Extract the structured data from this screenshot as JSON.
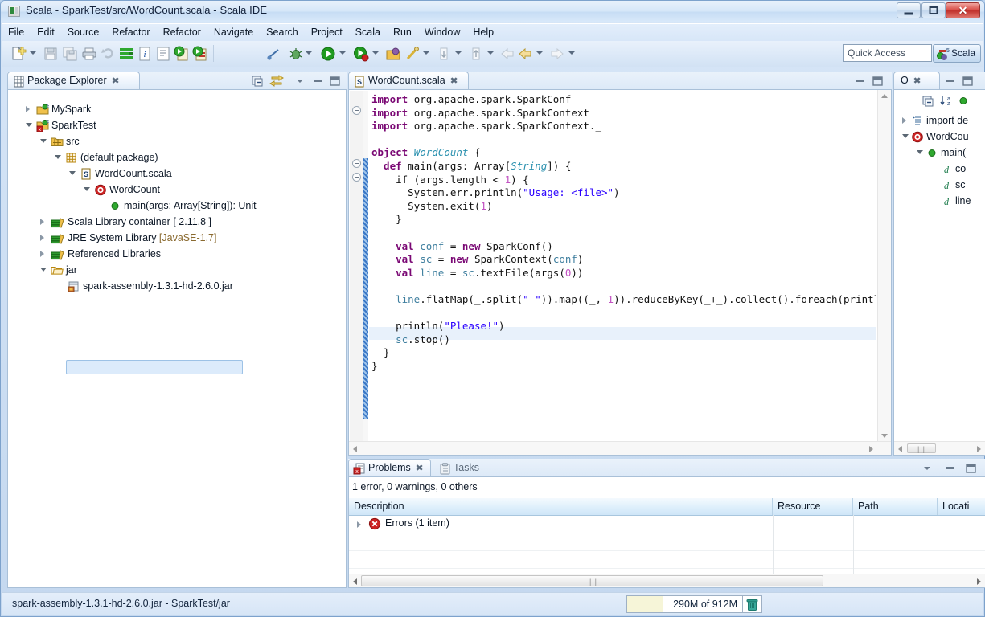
{
  "window": {
    "title": "Scala - SparkTest/src/WordCount.scala - Scala IDE",
    "icon": "scala-ide-icon",
    "controls": {
      "minimize": "–",
      "maximize": "□",
      "close": "✕"
    }
  },
  "menubar": {
    "items": [
      "File",
      "Edit",
      "Source",
      "Refactor",
      "Refactor",
      "Navigate",
      "Search",
      "Project",
      "Scala",
      "Run",
      "Window",
      "Help"
    ]
  },
  "toolbar": {
    "icons": [
      "new-wizard-icon",
      "save-icon",
      "save-all-icon",
      "print-icon",
      "refresh-icon",
      "scala-interpreter-icon",
      "scaladoc-icon",
      "comment-icon",
      "run-scala-app-icon",
      "run-scala-test-icon",
      "toggle-breakpoint-icon",
      "debug-icon",
      "run-icon",
      "run-coverage-icon",
      "open-type-icon",
      "search-icon",
      "next-annotation-icon",
      "previous-annotation-icon",
      "back-icon",
      "forward-icon"
    ],
    "quick_access_placeholder": "Quick Access",
    "quick_access_value": "",
    "open-perspective-icon": "open-perspective-icon",
    "perspective_label": "Scala",
    "perspective_icon": "scala-perspective-icon"
  },
  "package_explorer": {
    "tab_label": "Package Explorer",
    "tab_icon": "package-explorer-icon",
    "close_glyph": "✖",
    "buttons": [
      "collapse-all-icon",
      "link-with-editor-icon",
      "view-menu-icon",
      "minimize-icon",
      "maximize-icon"
    ],
    "tree": [
      {
        "label": "MySpark",
        "indent": 0,
        "twisty": "closed",
        "icon": "scala-project-icon"
      },
      {
        "label": "SparkTest",
        "indent": 0,
        "twisty": "open",
        "icon": "scala-project-error-icon"
      },
      {
        "label": "src",
        "indent": 1,
        "twisty": "open",
        "icon": "source-folder-icon"
      },
      {
        "label": "(default package)",
        "indent": 2,
        "twisty": "open",
        "icon": "package-icon"
      },
      {
        "label": "WordCount.scala",
        "indent": 3,
        "twisty": "open",
        "icon": "scala-file-icon"
      },
      {
        "label": "WordCount",
        "indent": 4,
        "twisty": "open",
        "icon": "scala-object-icon"
      },
      {
        "label": "main(args: Array[String]): Unit",
        "indent": 5,
        "twisty": "none",
        "icon": "method-public-icon"
      },
      {
        "label": "Scala Library container [ 2.11.8 ]",
        "indent": 1,
        "twisty": "closed",
        "icon": "library-icon"
      },
      {
        "label": "JRE System Library [JavaSE-1.7]",
        "indent": 1,
        "twisty": "closed",
        "icon": "library-icon",
        "suffix": "[JavaSE-1.7]"
      },
      {
        "label": "Referenced Libraries",
        "indent": 1,
        "twisty": "closed",
        "icon": "library-icon"
      },
      {
        "label": "jar",
        "indent": 1,
        "twisty": "open",
        "icon": "folder-icon"
      },
      {
        "label": "spark-assembly-1.3.1-hd-2.6.0.jar",
        "indent": 2,
        "twisty": "none",
        "icon": "jar-icon",
        "selected": true
      }
    ]
  },
  "editor": {
    "tab_label": "WordCount.scala",
    "tab_icon": "scala-file-icon",
    "close_glyph": "✖",
    "buttons": [
      "minimize-icon",
      "maximize-icon"
    ],
    "current_line_index": 18,
    "lines": [
      [
        {
          "t": "import ",
          "c": "k"
        },
        {
          "t": "org.apache.spark.SparkConf",
          "c": "id"
        }
      ],
      [
        {
          "t": "import ",
          "c": "k"
        },
        {
          "t": "org.apache.spark.SparkContext",
          "c": "id"
        }
      ],
      [
        {
          "t": "import ",
          "c": "k"
        },
        {
          "t": "org.apache.spark.SparkContext._",
          "c": "id"
        }
      ],
      [],
      [
        {
          "t": "object ",
          "c": "k"
        },
        {
          "t": "WordCount",
          "c": "t"
        },
        {
          "t": " {",
          "c": "id"
        }
      ],
      [
        {
          "t": "  def ",
          "c": "k"
        },
        {
          "t": "main(args: ",
          "c": "id"
        },
        {
          "t": "Array",
          "c": "id"
        },
        {
          "t": "[",
          "c": "id"
        },
        {
          "t": "String",
          "c": "t"
        },
        {
          "t": "]) {",
          "c": "id"
        }
      ],
      [
        {
          "t": "    if (args.length ",
          "c": "id"
        },
        {
          "t": "<",
          "c": "id"
        },
        {
          "t": " ",
          "c": "id"
        },
        {
          "t": "1",
          "c": "n"
        },
        {
          "t": ") {",
          "c": "id"
        }
      ],
      [
        {
          "t": "      System.err.println(",
          "c": "id"
        },
        {
          "t": "\"Usage: <file>\"",
          "c": "s"
        },
        {
          "t": ")",
          "c": "id"
        }
      ],
      [
        {
          "t": "      System.exit(",
          "c": "id"
        },
        {
          "t": "1",
          "c": "n"
        },
        {
          "t": ")",
          "c": "id"
        }
      ],
      [
        {
          "t": "    }",
          "c": "id"
        }
      ],
      [],
      [
        {
          "t": "    val ",
          "c": "k"
        },
        {
          "t": "conf",
          "c": "ty"
        },
        {
          "t": " = ",
          "c": "id"
        },
        {
          "t": "new ",
          "c": "k"
        },
        {
          "t": "SparkConf()",
          "c": "id"
        }
      ],
      [
        {
          "t": "    val ",
          "c": "k"
        },
        {
          "t": "sc",
          "c": "ty"
        },
        {
          "t": " = ",
          "c": "id"
        },
        {
          "t": "new ",
          "c": "k"
        },
        {
          "t": "SparkContext(",
          "c": "id"
        },
        {
          "t": "conf",
          "c": "ty"
        },
        {
          "t": ")",
          "c": "id"
        }
      ],
      [
        {
          "t": "    val ",
          "c": "k"
        },
        {
          "t": "line",
          "c": "ty"
        },
        {
          "t": " = ",
          "c": "id"
        },
        {
          "t": "sc",
          "c": "ty"
        },
        {
          "t": ".textFile(args(",
          "c": "id"
        },
        {
          "t": "0",
          "c": "n"
        },
        {
          "t": "))",
          "c": "id"
        }
      ],
      [],
      [
        {
          "t": "    ",
          "c": "id"
        },
        {
          "t": "line",
          "c": "ty"
        },
        {
          "t": ".flatMap(_.split(",
          "c": "id"
        },
        {
          "t": "\" \"",
          "c": "s"
        },
        {
          "t": ")).map((_, ",
          "c": "id"
        },
        {
          "t": "1",
          "c": "n"
        },
        {
          "t": ")).reduceByKey(_+_).collect().foreach(println)",
          "c": "id"
        }
      ],
      [],
      [
        {
          "t": "    println(",
          "c": "id"
        },
        {
          "t": "\"Please!\"",
          "c": "s"
        },
        {
          "t": ")",
          "c": "id"
        }
      ],
      [
        {
          "t": "    ",
          "c": "id"
        },
        {
          "t": "sc",
          "c": "ty"
        },
        {
          "t": ".stop()",
          "c": "id"
        }
      ],
      [
        {
          "t": "  }",
          "c": "id"
        }
      ],
      [
        {
          "t": "}",
          "c": "id"
        }
      ]
    ]
  },
  "outline": {
    "tab_label": "O",
    "tab_icon": "outline-icon",
    "close_glyph": "✖",
    "buttons": [
      "collapse-all-icon",
      "sort-icon",
      "hide-fields-icon",
      "view-menu-icon",
      "minimize-icon",
      "maximize-icon"
    ],
    "tree": [
      {
        "label": "import de",
        "indent": 0,
        "twisty": "closed",
        "icon": "import-declarations-icon"
      },
      {
        "label": "WordCou",
        "indent": 0,
        "twisty": "open",
        "icon": "scala-object-icon"
      },
      {
        "label": "main(",
        "indent": 1,
        "twisty": "open",
        "icon": "method-public-icon"
      },
      {
        "label": "co",
        "indent": 2,
        "twisty": "none",
        "icon": "val-icon"
      },
      {
        "label": "sc",
        "indent": 2,
        "twisty": "none",
        "icon": "val-icon"
      },
      {
        "label": "line",
        "indent": 2,
        "twisty": "none",
        "icon": "val-icon"
      }
    ]
  },
  "problems": {
    "tabs": [
      {
        "label": "Problems",
        "icon": "problems-icon",
        "active": true,
        "close_glyph": "✖"
      },
      {
        "label": "Tasks",
        "icon": "tasks-icon",
        "active": false
      }
    ],
    "buttons": [
      "view-menu-icon",
      "minimize-icon",
      "maximize-icon"
    ],
    "summary": "1 error, 0 warnings, 0 others",
    "columns": [
      "Description",
      "Resource",
      "Path",
      "Locati"
    ],
    "rows": [
      {
        "description": "Errors (1 item)",
        "twisty": "closed",
        "icon": "error-icon",
        "resource": "",
        "path": "",
        "location": ""
      }
    ]
  },
  "statusbar": {
    "text": "spark-assembly-1.3.1-hd-2.6.0.jar - SparkTest/jar",
    "heap": {
      "label": "290M of 912M",
      "used": "290M",
      "total": "912M",
      "fill_percent": 31
    },
    "gc_icon": "trash-icon"
  },
  "colors": {
    "accent": "#3a77c6",
    "error": "#cc0000",
    "keyword": "#7a0874",
    "string": "#2a00ff",
    "type": "#2b91af",
    "chrome": "#d7e6f7"
  }
}
